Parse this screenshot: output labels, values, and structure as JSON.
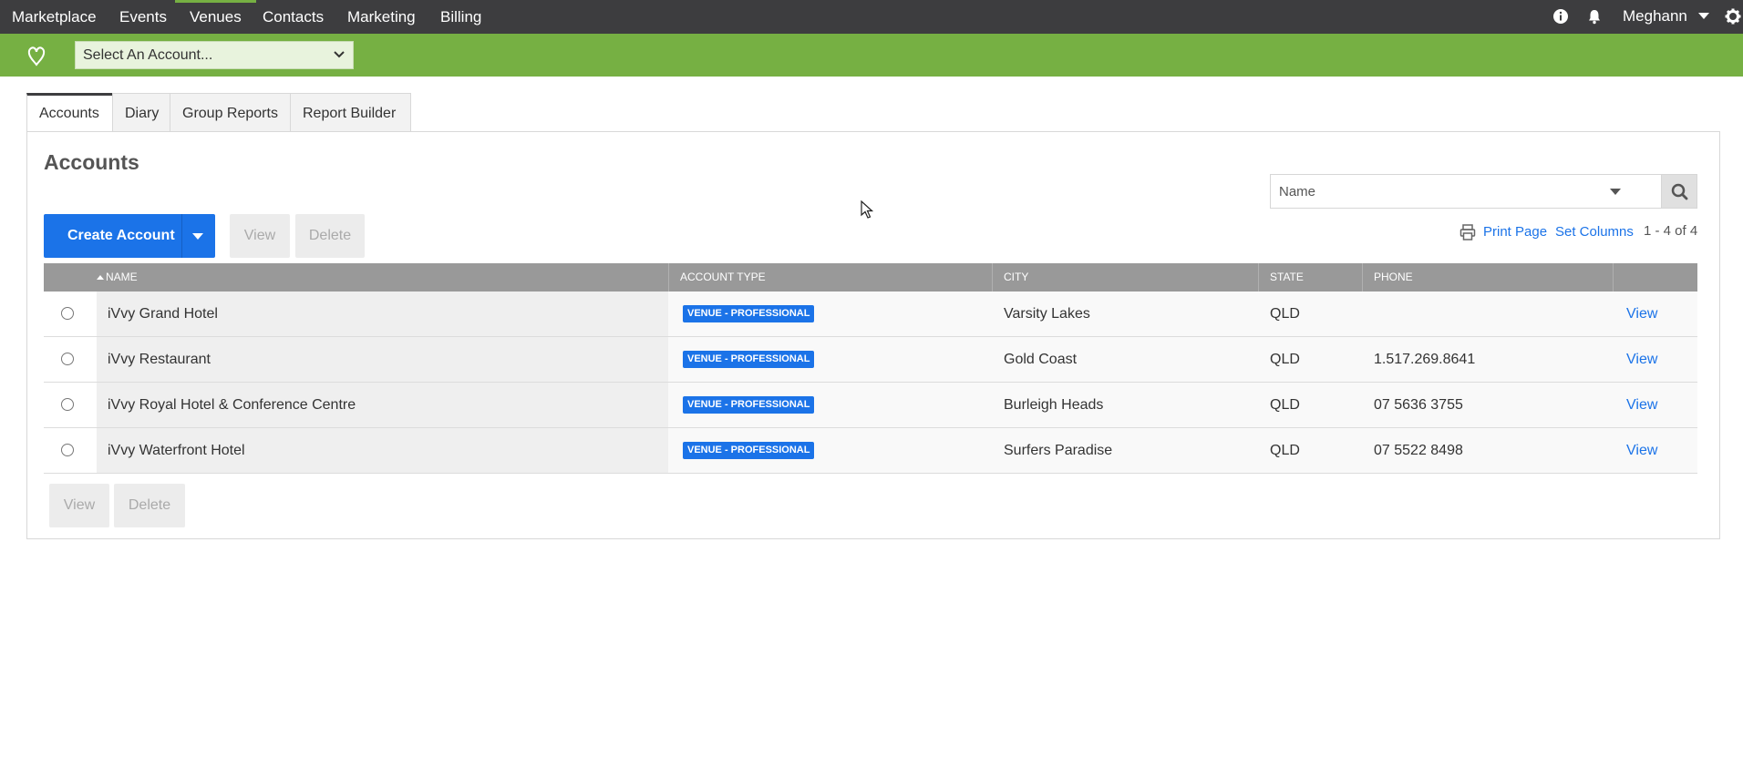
{
  "topnav": {
    "items": [
      "Marketplace",
      "Events",
      "Venues",
      "Contacts",
      "Marketing",
      "Billing"
    ],
    "active": "Venues",
    "user": "Meghann",
    "icons": [
      "info-icon",
      "bell-icon",
      "gear-icon"
    ]
  },
  "account_bar": {
    "select_value": "Select An Account...",
    "accent_color": "#76b043"
  },
  "tabs": [
    "Accounts",
    "Diary",
    "Group Reports",
    "Report Builder"
  ],
  "page": {
    "title": "Accounts",
    "search_placeholder": "Name",
    "create_label": "Create Account",
    "view_label": "View",
    "delete_label": "Delete",
    "print_label": "Print Page",
    "set_columns_label": "Set Columns",
    "count": "1 - 4 of 4"
  },
  "table": {
    "columns": [
      "NAME",
      "ACCOUNT TYPE",
      "CITY",
      "STATE",
      "PHONE"
    ],
    "sort_column": "NAME",
    "rows": [
      {
        "name": "iVvy Grand Hotel",
        "type": "VENUE - PROFESSIONAL",
        "city": "Varsity Lakes",
        "state": "QLD",
        "phone": "",
        "action": "View"
      },
      {
        "name": "iVvy Restaurant",
        "type": "VENUE - PROFESSIONAL",
        "city": "Gold Coast",
        "state": "QLD",
        "phone": "1.517.269.8641",
        "action": "View"
      },
      {
        "name": "iVvy Royal Hotel & Conference Centre",
        "type": "VENUE - PROFESSIONAL",
        "city": "Burleigh Heads",
        "state": "QLD",
        "phone": "07 5636 3755",
        "action": "View"
      },
      {
        "name": "iVvy Waterfront Hotel",
        "type": "VENUE - PROFESSIONAL",
        "city": "Surfers Paradise",
        "state": "QLD",
        "phone": "07 5522 8498",
        "action": "View"
      }
    ]
  },
  "colors": {
    "nav_bg": "#3d3d3f",
    "primary": "#1b73e8",
    "table_header": "#999999"
  }
}
